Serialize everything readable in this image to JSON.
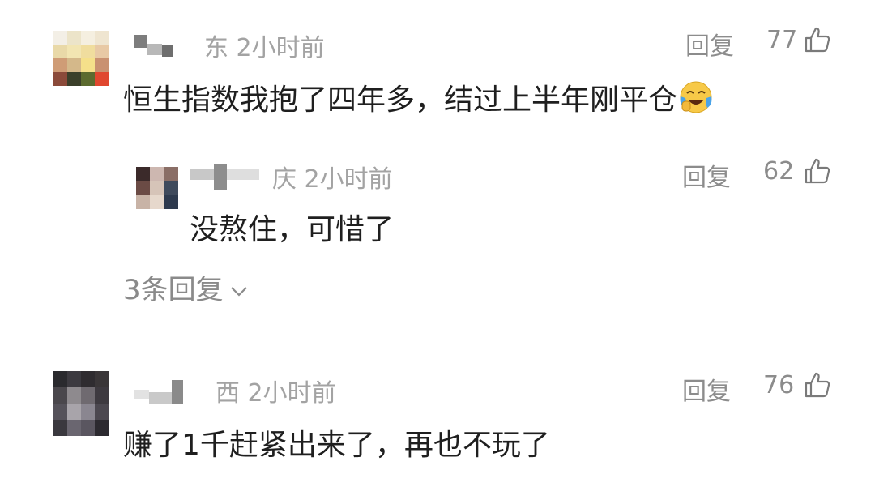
{
  "comments": [
    {
      "location_time": "东 2小时前",
      "reply_label": "回复",
      "likes": "77",
      "text": "恒生指数我抱了四年多，结过上半年刚平仓",
      "emoji": "crying-laughing-emoji",
      "replies": [
        {
          "location_time": "庆 2小时前",
          "reply_label": "回复",
          "likes": "62",
          "text": "没熬住，可惜了"
        }
      ],
      "more_replies": "3条回复"
    },
    {
      "location_time": "西 2小时前",
      "reply_label": "回复",
      "likes": "76",
      "text": "赚了1千赶紧出来了，再也不玩了"
    }
  ],
  "colors": {
    "meta_gray": "#a3a3a3",
    "text": "#1f1f1f",
    "emoji_face": "#f7c948"
  }
}
